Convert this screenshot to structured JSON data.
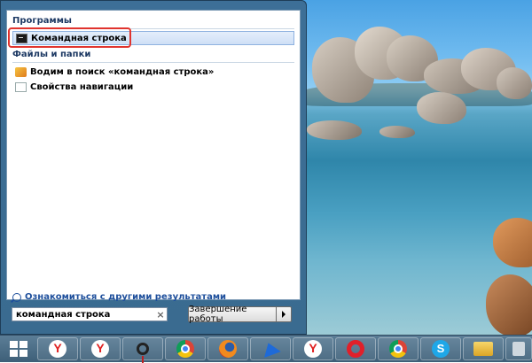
{
  "start_menu": {
    "programs_header": "Программы",
    "programs": [
      {
        "label": "Командная строка",
        "icon": "cmd-icon",
        "selected": true
      }
    ],
    "files_header": "Файлы и папки",
    "files": [
      {
        "label": "Водим в поиск «командная строка»",
        "icon": "search-document-icon"
      },
      {
        "label": "Свойства навигации",
        "icon": "document-icon"
      }
    ],
    "more_results": "Ознакомиться с другими результатами",
    "search": {
      "value": "командная строка",
      "clear_glyph": "×"
    },
    "shutdown_label": "Завершение работы"
  },
  "taskbar": {
    "items": [
      {
        "icon": "windows-logo-icon",
        "name": "start-button"
      },
      {
        "icon": "yandex-browser-icon"
      },
      {
        "icon": "yandex-browser-icon"
      },
      {
        "icon": "pin-marker-icon"
      },
      {
        "icon": "chrome-icon"
      },
      {
        "icon": "firefox-icon"
      },
      {
        "icon": "bird-app-icon"
      },
      {
        "icon": "yandex-browser-icon"
      },
      {
        "icon": "opera-icon"
      },
      {
        "icon": "chrome-icon"
      },
      {
        "icon": "skype-icon"
      },
      {
        "icon": "folder-icon"
      }
    ]
  },
  "colors": {
    "highlight_box": "#e0342e",
    "menu_frame": "#3d6f97",
    "link_text": "#1e4f9c",
    "taskbar": "#4e7089"
  }
}
